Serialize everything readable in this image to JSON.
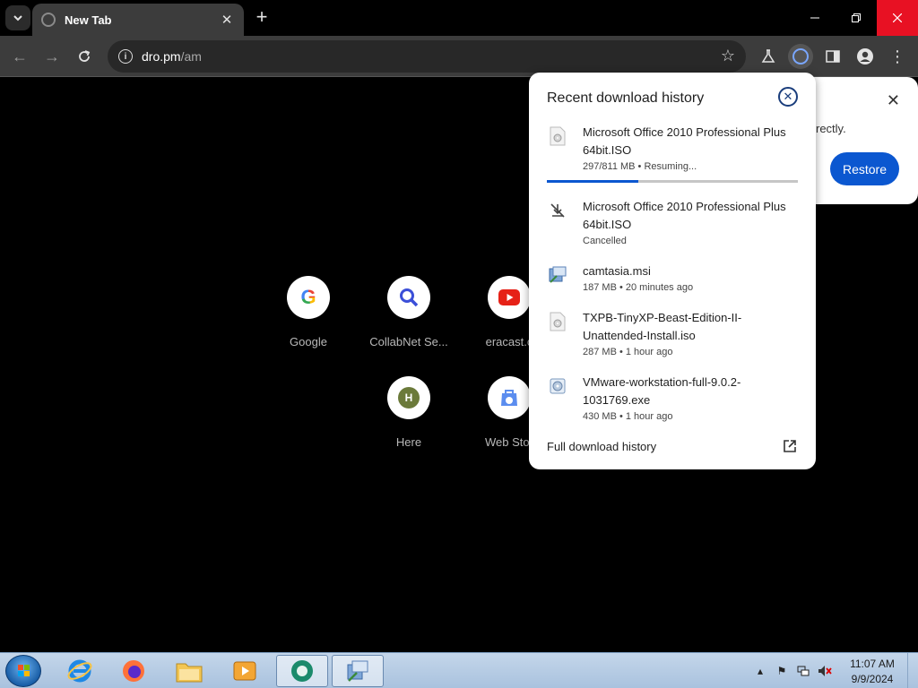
{
  "tab": {
    "title": "New Tab"
  },
  "omnibox": {
    "host": "dro.pm",
    "path": "/am"
  },
  "shortcuts": [
    {
      "label": "Google",
      "letter": "G"
    },
    {
      "label": "CollabNet Se...",
      "letter": ""
    },
    {
      "label": "eracast.c",
      "letter": ""
    },
    {
      "label": "Here",
      "letter": "H"
    },
    {
      "label": "Web Stor",
      "letter": ""
    }
  ],
  "restore_bubble": {
    "text": "rectly.",
    "button": "Restore"
  },
  "downloads": {
    "title": "Recent download history",
    "items": [
      {
        "name": "Microsoft Office 2010 Professional Plus 64bit.ISO",
        "status": "297/811 MB • Resuming...",
        "progress": 0.366,
        "icon": "disc-file-icon"
      },
      {
        "name": "Microsoft Office 2010 Professional Plus 64bit.ISO",
        "status": "Cancelled",
        "icon": "download-off-icon"
      },
      {
        "name": "camtasia.msi",
        "status": "187 MB • 20 minutes ago",
        "icon": "installer-icon"
      },
      {
        "name": "TXPB-TinyXP-Beast-Edition-II-Unattended-Install.iso",
        "status": "287 MB • 1 hour ago",
        "icon": "disc-file-icon"
      },
      {
        "name": "VMware-workstation-full-9.0.2-1031769.exe",
        "status": "430 MB • 1 hour ago",
        "icon": "setup-exe-icon"
      }
    ],
    "full_history": "Full download history"
  },
  "clock": {
    "time": "11:07 AM",
    "date": "9/9/2024"
  },
  "colors": {
    "accent": "#0b57d0",
    "close_red": "#e81123",
    "bubble_bg": "#ffffff"
  }
}
